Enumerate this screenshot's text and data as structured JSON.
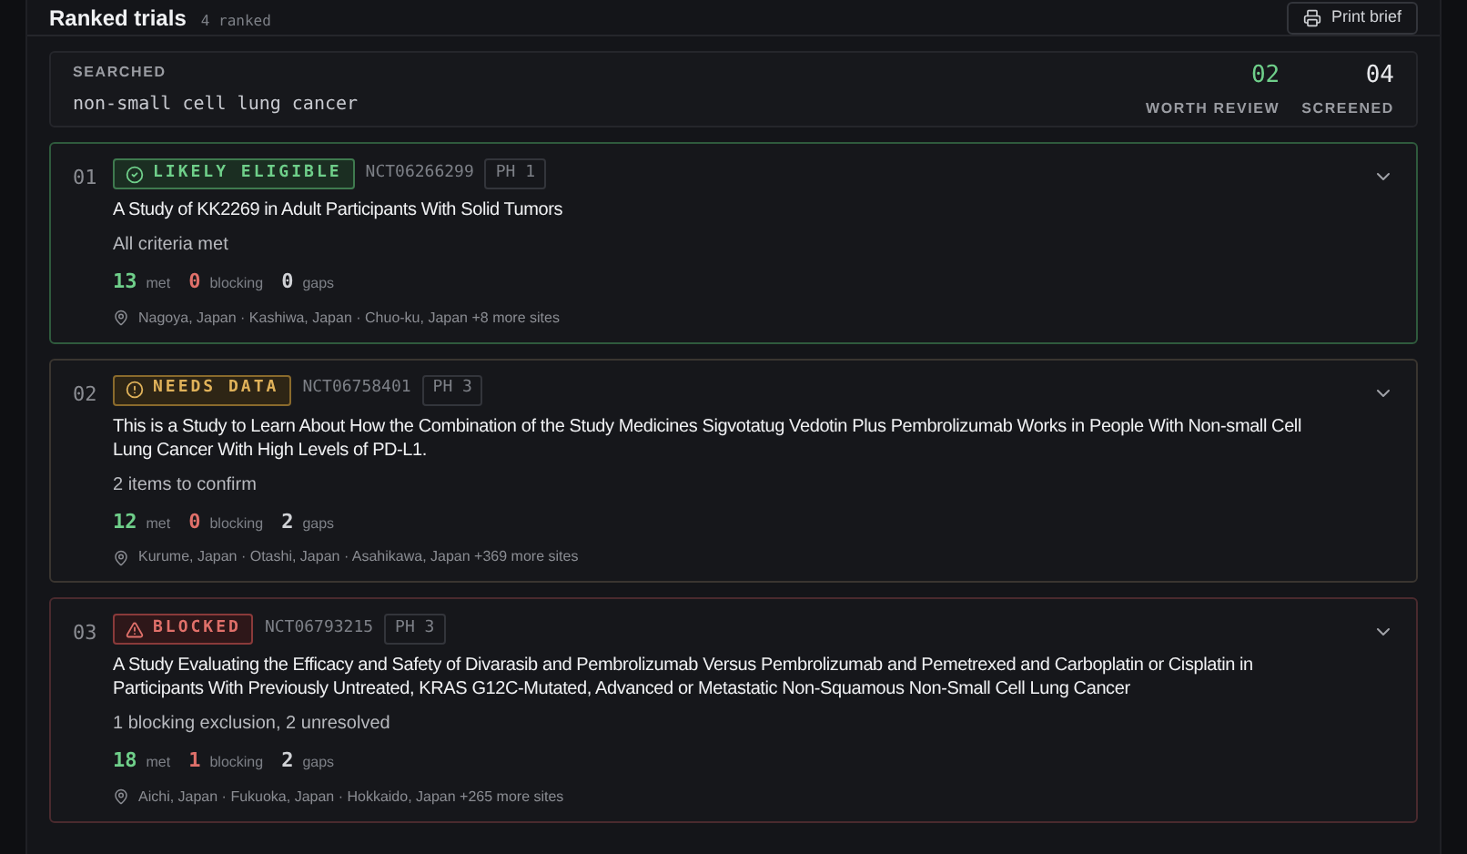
{
  "header": {
    "title": "Ranked trials",
    "count": "4 ranked",
    "print_button": "Print brief"
  },
  "search": {
    "label": "SEARCHED",
    "query": "non-small cell lung cancer",
    "stats": [
      {
        "value": "02",
        "label": "WORTH REVIEW",
        "kind": "highlight"
      },
      {
        "value": "04",
        "label": "SCREENED",
        "kind": "plain"
      }
    ]
  },
  "trials": [
    {
      "rank": "01",
      "status": "LIKELY ELIGIBLE",
      "kind": "eligible",
      "nct": "NCT06266299",
      "phase": "PH 1",
      "expanded": false,
      "title": "A Study of KK2269 in Adult Participants With Solid Tumors",
      "summary": "All criteria met",
      "met": "13",
      "met_label": "met",
      "blocking": "0",
      "blocking_label": "blocking",
      "gaps": "0",
      "gaps_label": "gaps",
      "sites": "Nagoya, Japan · Kashiwa, Japan · Chuo-ku, Japan +8 more sites"
    },
    {
      "rank": "02",
      "status": "NEEDS DATA",
      "kind": "needs_data",
      "nct": "NCT06758401",
      "phase": "PH 3",
      "expanded": false,
      "title": "This is a Study to Learn About How the Combination of the Study Medicines Sigvotatug Vedotin Plus Pembrolizumab Works in People With Non-small Cell Lung Cancer With High Levels of PD-L1.",
      "summary": "2 items to confirm",
      "met": "12",
      "met_label": "met",
      "blocking": "0",
      "blocking_label": "blocking",
      "gaps": "2",
      "gaps_label": "gaps",
      "sites": "Kurume, Japan · Otashi, Japan · Asahikawa, Japan +369 more sites"
    },
    {
      "rank": "03",
      "status": "BLOCKED",
      "kind": "blocked",
      "nct": "NCT06793215",
      "phase": "PH 3",
      "expanded": false,
      "title": "A Study Evaluating the Efficacy and Safety of Divarasib and Pembrolizumab Versus Pembrolizumab and Pemetrexed and Carboplatin or Cisplatin in Participants With Previously Untreated, KRAS G12C-Mutated, Advanced or Metastatic Non-Squamous Non-Small Cell Lung Cancer",
      "summary": "1 blocking exclusion, 2 unresolved",
      "met": "18",
      "met_label": "met",
      "blocking": "1",
      "blocking_label": "blocking",
      "gaps": "2",
      "gaps_label": "gaps",
      "sites": "Aichi, Japan · Fukuoka, Japan · Hokkaido, Japan +265 more sites"
    }
  ]
}
